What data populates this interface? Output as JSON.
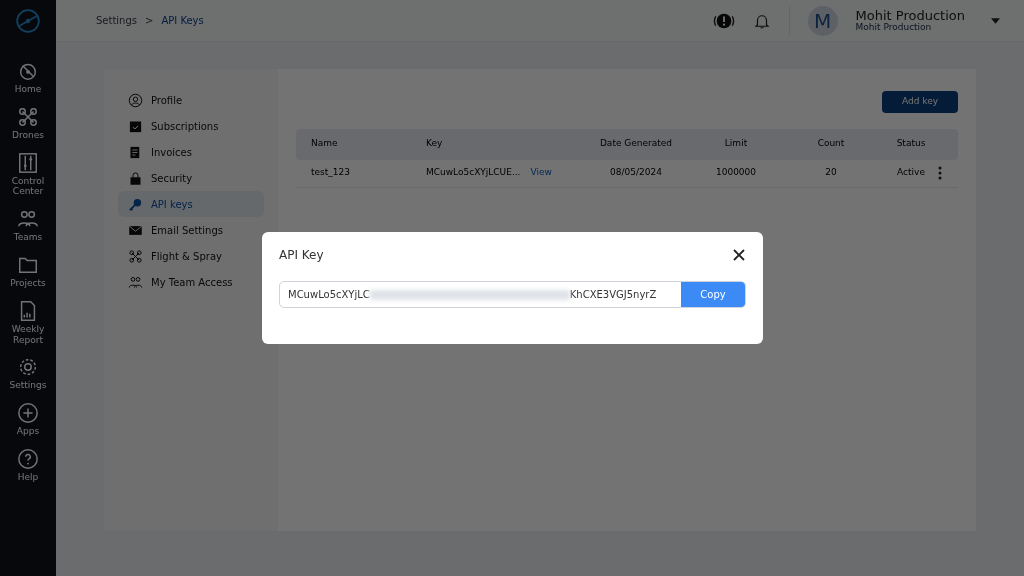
{
  "sidebar": {
    "items": [
      {
        "label": "Home"
      },
      {
        "label": "Drones"
      },
      {
        "label": "Control Center"
      },
      {
        "label": "Teams"
      },
      {
        "label": "Projects"
      },
      {
        "label": "Weekly Report"
      },
      {
        "label": "Settings"
      },
      {
        "label": "Apps"
      },
      {
        "label": "Help"
      }
    ]
  },
  "breadcrumb": {
    "parent": "Settings",
    "separator": ">",
    "current": "API Keys"
  },
  "user": {
    "initial": "M",
    "name": "Mohit Production",
    "subtitle": "Mohit Production"
  },
  "settings_menu": [
    {
      "label": "Profile",
      "selected": false
    },
    {
      "label": "Subscriptions",
      "selected": false
    },
    {
      "label": "Invoices",
      "selected": false
    },
    {
      "label": "Security",
      "selected": false
    },
    {
      "label": "API keys",
      "selected": true
    },
    {
      "label": "Email Settings",
      "selected": false
    },
    {
      "label": "Flight & Spray",
      "selected": false
    },
    {
      "label": "My Team Access",
      "selected": false
    }
  ],
  "add_button": "Add key",
  "table": {
    "columns": [
      "Name",
      "Key",
      "Date Generated",
      "Limit",
      "Count",
      "Status"
    ],
    "rows": [
      {
        "name": "test_123",
        "key": "MCuwLo5cXYjLCUE...",
        "view": "View",
        "date": "08/05/2024",
        "limit": "1000000",
        "count": "20",
        "status": "Active"
      }
    ]
  },
  "modal": {
    "title": "API Key",
    "key_start": "MCuwLo5cXYjLC",
    "key_end": "KhCXE3VGJ5nyrZ",
    "copy": "Copy"
  }
}
